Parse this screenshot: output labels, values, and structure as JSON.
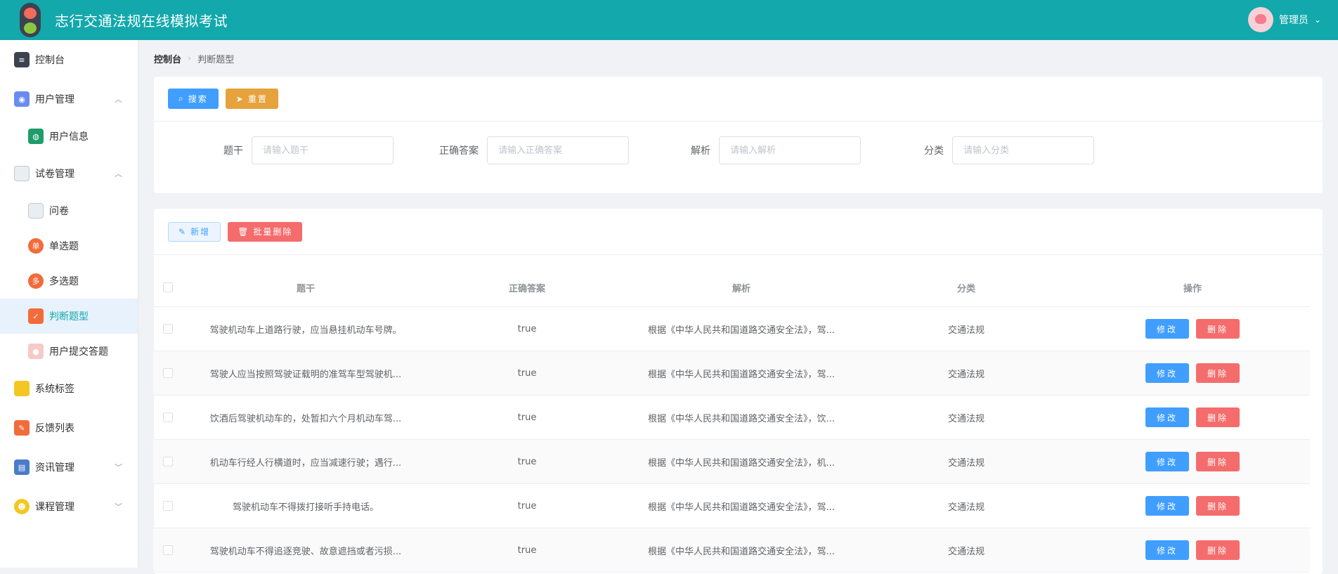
{
  "header": {
    "title": "志行交通法规在线模拟考试",
    "user": "管理员"
  },
  "sidebar": {
    "items": [
      {
        "label": "控制台"
      },
      {
        "label": "用户管理"
      },
      {
        "label": "用户信息"
      },
      {
        "label": "试卷管理"
      },
      {
        "label": "问卷"
      },
      {
        "label": "单选题",
        "icon_text": "单"
      },
      {
        "label": "多选题",
        "icon_text": "多"
      },
      {
        "label": "判断题型"
      },
      {
        "label": "用户提交答题"
      },
      {
        "label": "系统标签"
      },
      {
        "label": "反馈列表"
      },
      {
        "label": "资讯管理"
      },
      {
        "label": "课程管理"
      }
    ]
  },
  "breadcrumb": {
    "root": "控制台",
    "current": "判断题型"
  },
  "search": {
    "search_btn": "搜索",
    "reset_btn": "重置",
    "fields": [
      {
        "label": "题干",
        "placeholder": "请输入题干"
      },
      {
        "label": "正确答案",
        "placeholder": "请输入正确答案"
      },
      {
        "label": "解析",
        "placeholder": "请输入解析"
      },
      {
        "label": "分类",
        "placeholder": "请输入分类"
      }
    ]
  },
  "toolbar": {
    "add_btn": "新增",
    "batch_delete_btn": "批量删除"
  },
  "table": {
    "headers": [
      "题干",
      "正确答案",
      "解析",
      "分类",
      "操作"
    ],
    "edit_label": "修改",
    "delete_label": "删除",
    "rows": [
      {
        "stem": "驾驶机动车上道路行驶，应当悬挂机动车号牌。",
        "answer": "true",
        "analysis": "根据《中华人民共和国道路交通安全法》，驾...",
        "category": "交通法规"
      },
      {
        "stem": "驾驶人应当按照驾驶证载明的准驾车型驾驶机...",
        "answer": "true",
        "analysis": "根据《中华人民共和国道路交通安全法》，驾...",
        "category": "交通法规"
      },
      {
        "stem": "饮酒后驾驶机动车的，处暂扣六个月机动车驾...",
        "answer": "true",
        "analysis": "根据《中华人民共和国道路交通安全法》，饮...",
        "category": "交通法规"
      },
      {
        "stem": "机动车行经人行横道时，应当减速行驶；遇行...",
        "answer": "true",
        "analysis": "根据《中华人民共和国道路交通安全法》，机...",
        "category": "交通法规"
      },
      {
        "stem": "驾驶机动车不得拨打接听手持电话。",
        "answer": "true",
        "analysis": "根据《中华人民共和国道路交通安全法》，驾...",
        "category": "交通法规"
      },
      {
        "stem": "驾驶机动车不得追逐竞驶、故意遮挡或者污损...",
        "answer": "true",
        "analysis": "根据《中华人民共和国道路交通安全法》，驾...",
        "category": "交通法规"
      }
    ]
  },
  "colors": {
    "header_bg": "#12a8ac",
    "primary": "#409eff",
    "danger": "#f56c6c",
    "warning": "#e6a23c"
  }
}
